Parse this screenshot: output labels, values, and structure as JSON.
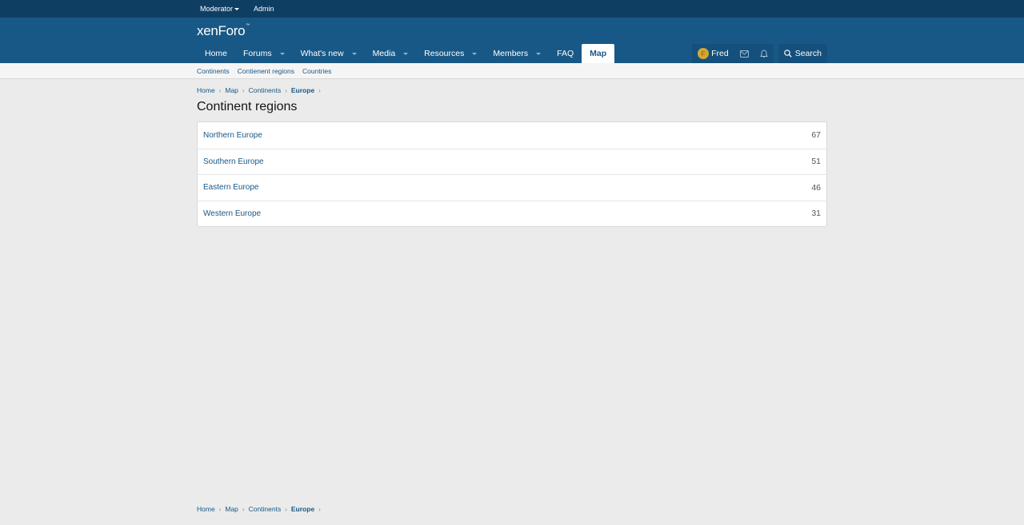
{
  "staffbar": {
    "moderator_label": "Moderator",
    "admin_label": "Admin"
  },
  "header": {
    "logo_xen": "xen",
    "logo_foro": "Foro"
  },
  "nav": {
    "tabs": [
      {
        "label": "Home"
      },
      {
        "label": "Forums"
      },
      {
        "label": "What's new"
      },
      {
        "label": "Media"
      },
      {
        "label": "Resources"
      },
      {
        "label": "Members"
      },
      {
        "label": "FAQ"
      },
      {
        "label": "Map"
      }
    ]
  },
  "user": {
    "avatar_letter": "F",
    "name": "Fred",
    "search_label": "Search"
  },
  "subnav": {
    "items": [
      {
        "label": "Continents"
      },
      {
        "label": "Contienent regions"
      },
      {
        "label": "Countries"
      }
    ]
  },
  "breadcrumb": {
    "items": [
      {
        "label": "Home"
      },
      {
        "label": "Map"
      },
      {
        "label": "Continents"
      },
      {
        "label": "Europe"
      }
    ]
  },
  "page": {
    "title": "Continent regions"
  },
  "regions": [
    {
      "name": "Northern Europe",
      "count": "67"
    },
    {
      "name": "Southern Europe",
      "count": "51"
    },
    {
      "name": "Eastern Europe",
      "count": "46"
    },
    {
      "name": "Western Europe",
      "count": "31"
    }
  ],
  "colors": {
    "staffbar": "#0f3e63",
    "header": "#185886",
    "link": "#185886",
    "background": "#ebebeb"
  }
}
